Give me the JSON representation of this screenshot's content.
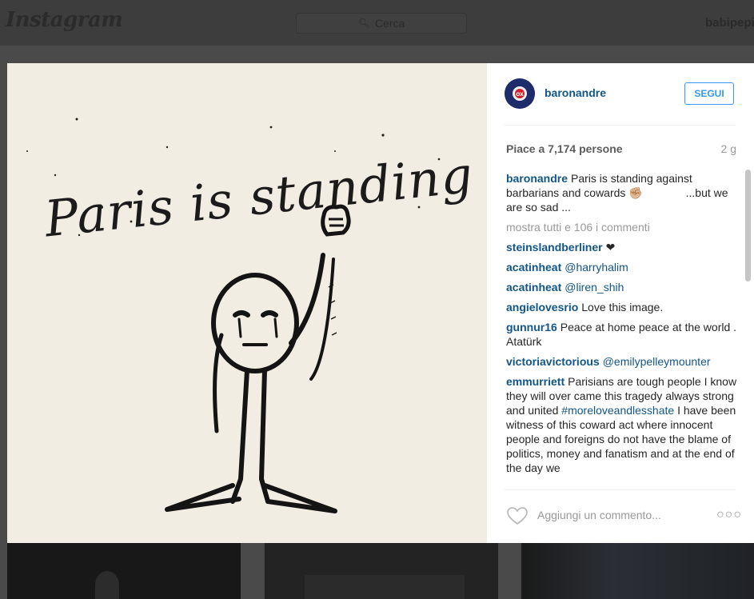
{
  "topbar": {
    "logo": "Instagram",
    "search_placeholder": "Cerca",
    "username": "babipepi"
  },
  "post": {
    "author": "baronandre",
    "follow_label": "SEGUI",
    "likes": "Piace a 7,174 persone",
    "age": "2 g",
    "show_all": "mostra tutti e 106 i commenti",
    "add_comment_placeholder": "Aggiungi un commento...",
    "avatar_text": "ANDRE PARIS",
    "image_text": "Paris is standing",
    "caption": {
      "user": "baronandre",
      "text_part1": "Paris is standing against barbarians and cowards",
      "emoji": "✊🏼",
      "text_part2": "...but we are so sad ..."
    },
    "comments": [
      {
        "user": "steinslandberliner",
        "text": "❤"
      },
      {
        "user": "acatinheat",
        "text": "@harryhalim"
      },
      {
        "user": "acatinheat",
        "text": "@liren_shih"
      },
      {
        "user": "angielovesrio",
        "text": "Love this image."
      },
      {
        "user": "gunnur16",
        "text": "Peace at home peace at the world . Atatürk"
      },
      {
        "user": "victoriavictorious",
        "text": "@emilypelleymounter"
      },
      {
        "user": "emmurriett",
        "text_part1": "Parisians are tough people I know they will over came this tragedy always strong and united",
        "hashtag": "#moreloveandlesshate",
        "text_part2": "I have been witness of this coward act where innocent people and foreigns do not have the blame of politics, money and fanatism and at the end of the day we"
      }
    ]
  },
  "colors": {
    "link": "#125688",
    "follow_blue": "#3897f0",
    "muted": "#999999"
  }
}
